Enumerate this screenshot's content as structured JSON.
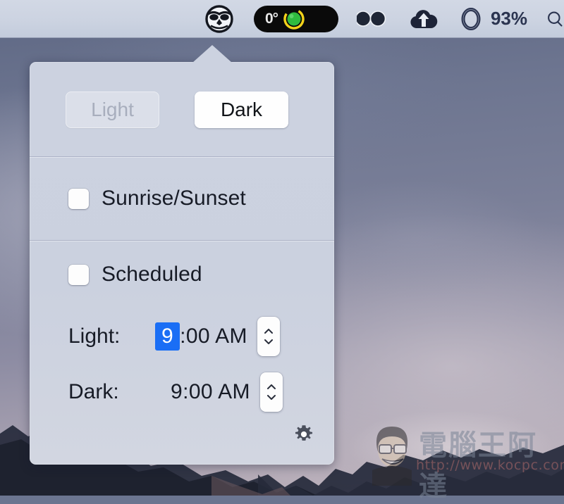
{
  "menubar": {
    "items": [
      {
        "name": "nightowl-icon",
        "label": "NightOwl",
        "type": "icon"
      },
      {
        "name": "temperature-indicator",
        "label": "0°",
        "type": "pill"
      },
      {
        "name": "adobe-creative-cloud-icon",
        "label": "Creative Cloud",
        "type": "icon"
      },
      {
        "name": "cloud-upload-icon",
        "label": "Backup",
        "type": "icon"
      },
      {
        "name": "battery-icon",
        "label": "93%",
        "type": "icon-text"
      },
      {
        "name": "spotlight-search-icon",
        "label": "Search",
        "type": "icon"
      }
    ],
    "temperature": "0°",
    "battery_percent": "93%"
  },
  "popover": {
    "modes": [
      {
        "label": "Light",
        "state": "inactive"
      },
      {
        "label": "Dark",
        "state": "active"
      }
    ],
    "options": [
      {
        "label": "Sunrise/Sunset",
        "checked": false
      },
      {
        "label": "Scheduled",
        "checked": false
      }
    ],
    "schedule": [
      {
        "label": "Light:",
        "time_selected": "9",
        "time_rest": ":00 AM",
        "time_full": "9:00 AM",
        "has_selection": true
      },
      {
        "label": "Dark:",
        "time_selected": "",
        "time_rest": "9:00 AM",
        "time_full": "9:00 AM",
        "has_selection": false
      }
    ],
    "settings_icon": "gear-icon"
  },
  "watermark": {
    "title": "電腦王阿達",
    "url": "http://www.kocpc.com.tw"
  },
  "colors": {
    "accent_selection": "#1a6ef5",
    "popover_bg": "#ccd2e0",
    "menubar_bg": "#ccd3e1",
    "text": "#171b26"
  }
}
